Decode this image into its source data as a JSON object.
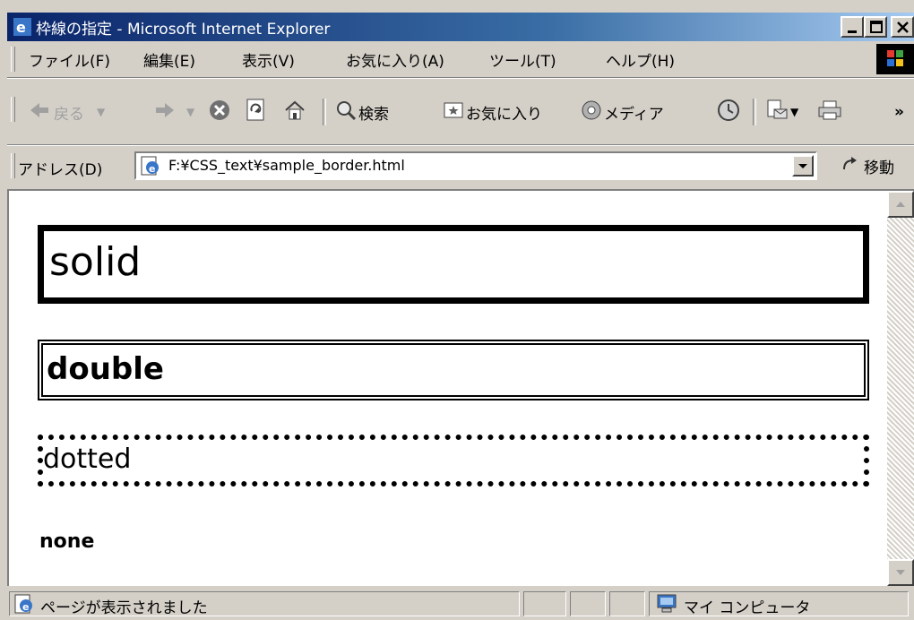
{
  "window": {
    "title": "枠線の指定 - Microsoft Internet Explorer"
  },
  "menu": {
    "items": [
      "ファイル(F)",
      "編集(E)",
      "表示(V)",
      "お気に入り(A)",
      "ツール(T)",
      "ヘルプ(H)"
    ]
  },
  "toolbar": {
    "back": "戻る",
    "search": "検索",
    "favorites": "お気に入り",
    "media": "メディア"
  },
  "address": {
    "label": "アドレス(D)",
    "url": "F:¥CSS_text¥sample_border.html",
    "go": "移動"
  },
  "content": {
    "solid": "solid",
    "double": "double",
    "dotted": "dotted",
    "none": "none"
  },
  "status": {
    "message": "ページが表示されました",
    "zone": "マイ コンピュータ"
  },
  "colors": {
    "titlebar_start": "#0a246a",
    "titlebar_end": "#a6caf0",
    "chrome": "#d4d0c8"
  }
}
